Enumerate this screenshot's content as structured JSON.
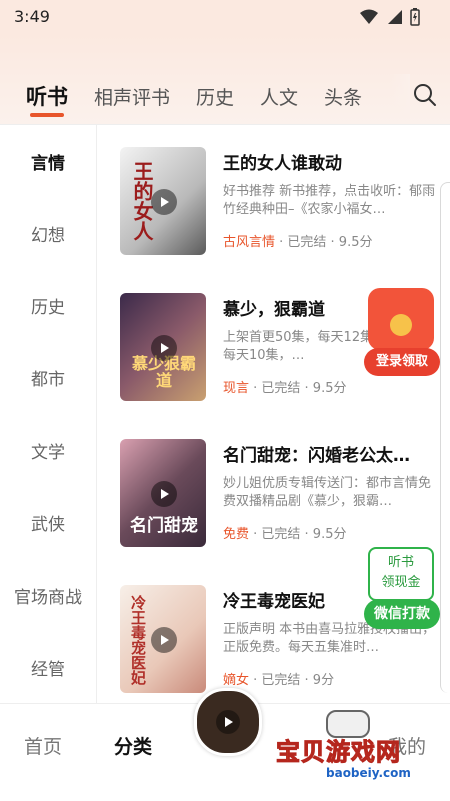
{
  "status": {
    "time": "3:49"
  },
  "tabs": [
    {
      "label": "听书"
    },
    {
      "label": "相声评书"
    },
    {
      "label": "历史"
    },
    {
      "label": "人文"
    },
    {
      "label": "头条"
    }
  ],
  "sidebar": {
    "items": [
      {
        "label": "言情"
      },
      {
        "label": "幻想"
      },
      {
        "label": "历史"
      },
      {
        "label": "都市"
      },
      {
        "label": "文学"
      },
      {
        "label": "武侠"
      },
      {
        "label": "官场商战"
      },
      {
        "label": "经管"
      }
    ]
  },
  "books": [
    {
      "title": "王的女人谁敢动",
      "desc": "好书推荐  新书推荐，点击收听：郁雨竹经典种田–《农家小福女…",
      "tag": "古风言情",
      "meta": " · 已完结 · 9.5分",
      "cover_text": "王的女人"
    },
    {
      "title": "慕少，狠霸道",
      "desc": "上架首更50集，每天12集，第一周每天10集，…",
      "tag": "现言",
      "meta": " · 已完结 · 9.5分",
      "cover_text": "慕少狠霸道"
    },
    {
      "title": "名门甜宠：闪婚老公太…",
      "desc": "妙儿姐优质专辑传送门：都市言情免费双播精品剧《慕少，狠霸…",
      "tag": "免费",
      "meta": " · 已完结 · 9.5分",
      "cover_text": "名门甜宠"
    },
    {
      "title": "冷王毒宠医妃",
      "desc": "正版声明  本书由喜马拉雅授权播出，正版免费。每天五集准时…",
      "tag": "嫡女",
      "meta": " · 已完结 · 9分",
      "cover_text": "冷王毒宠医妃"
    }
  ],
  "float": {
    "redpacket_label": "登录领取",
    "wx_line1": "听书",
    "wx_line2": "领现金",
    "wx_button": "微信打款"
  },
  "bottom_nav": [
    {
      "label": "首页"
    },
    {
      "label": "分类"
    },
    {
      "label": "我的"
    }
  ],
  "watermark": {
    "title": "宝贝游戏网",
    "url": "baobeiy.com"
  },
  "colors": {
    "accent": "#e8552b",
    "wechat_green": "#2fb34a"
  }
}
